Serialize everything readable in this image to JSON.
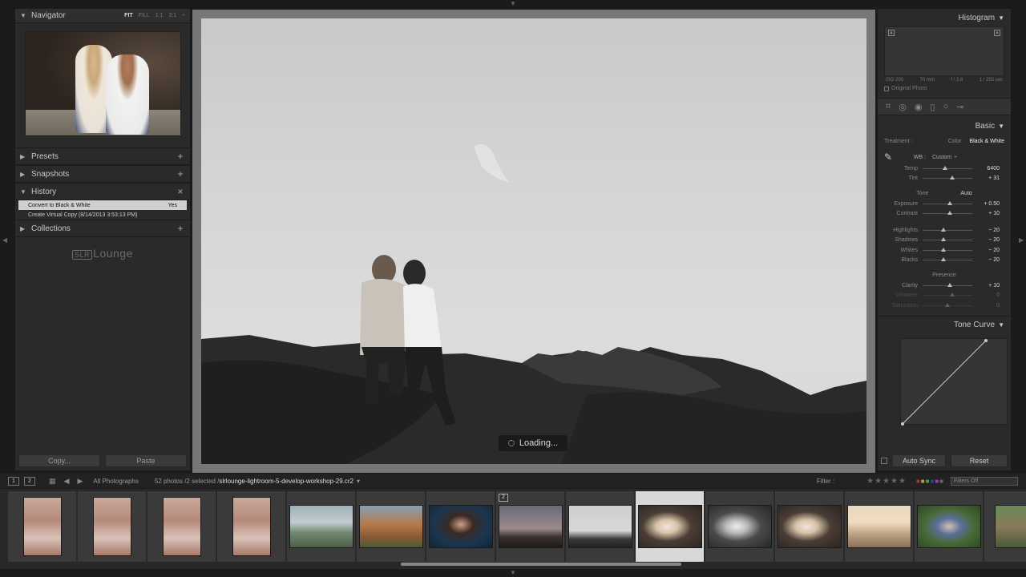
{
  "navigator": {
    "title": "Navigator",
    "zoom_options": [
      "FIT",
      "FILL",
      "1:1",
      "3:1"
    ],
    "zoom_extra": "÷"
  },
  "left_sections": {
    "presets": "Presets",
    "snapshots": "Snapshots",
    "history": "History",
    "collections": "Collections"
  },
  "history": {
    "items": [
      {
        "name": "Convert to Black & White",
        "value": "Yes"
      },
      {
        "name": "Create Virtual Copy (8/14/2013 3:53:13 PM)",
        "value": ""
      }
    ]
  },
  "brand": {
    "box": "SLR",
    "text": "Lounge"
  },
  "left_buttons": {
    "copy": "Copy...",
    "paste": "Paste"
  },
  "loading": "Loading...",
  "histogram": {
    "title": "Histogram",
    "iso": "ISO 200",
    "focal": "70 mm",
    "aperture": "f / 2.8",
    "shutter": "1 / 250 sec",
    "original": "Original Photo"
  },
  "basic": {
    "title": "Basic",
    "treatment_label": "Treatment :",
    "treatment_options": [
      "Color",
      "Black & White"
    ],
    "wb_label": "WB :",
    "wb_value": "Custom",
    "tone_label": "Tone",
    "auto_label": "Auto",
    "presence_label": "Presence",
    "sliders_wb": [
      {
        "label": "Temp",
        "value": "6400",
        "pos": 0.45
      },
      {
        "label": "Tint",
        "value": "+ 31",
        "pos": 0.6
      }
    ],
    "sliders_tone": [
      {
        "label": "Exposure",
        "value": "+ 0.50",
        "pos": 0.55
      },
      {
        "label": "Contrast",
        "value": "+ 10",
        "pos": 0.55
      }
    ],
    "sliders_tone2": [
      {
        "label": "Highlights",
        "value": "− 20",
        "pos": 0.42
      },
      {
        "label": "Shadows",
        "value": "− 20",
        "pos": 0.42
      },
      {
        "label": "Whites",
        "value": "− 20",
        "pos": 0.42
      },
      {
        "label": "Blacks",
        "value": "− 20",
        "pos": 0.42
      }
    ],
    "sliders_presence": [
      {
        "label": "Clarity",
        "value": "+ 10",
        "pos": 0.55
      },
      {
        "label": "Vibrance",
        "value": "0",
        "pos": 0.6
      },
      {
        "label": "Saturation",
        "value": "0",
        "pos": 0.5
      }
    ]
  },
  "tone_curve": {
    "title": "Tone Curve"
  },
  "right_buttons": {
    "auto_sync": "Auto Sync",
    "reset": "Reset"
  },
  "filmstrip_bar": {
    "page1": "1",
    "page2": "2",
    "source": "All Photographs",
    "count": "52 photos /2 selected /",
    "filename": "slrlounge-lightroom-5-develop-workshop-29.cr2",
    "filter_label": "Filter :",
    "filter_value": "Filters Off"
  },
  "filmstrip": {
    "thumbs": [
      {
        "kind": "canyon",
        "selected": false,
        "badge": ""
      },
      {
        "kind": "canyon",
        "selected": false,
        "badge": ""
      },
      {
        "kind": "canyon",
        "selected": false,
        "badge": ""
      },
      {
        "kind": "canyon",
        "selected": false,
        "badge": ""
      },
      {
        "kind": "coast",
        "selected": false,
        "badge": ""
      },
      {
        "kind": "redrock",
        "selected": false,
        "badge": ""
      },
      {
        "kind": "portrait",
        "selected": false,
        "badge": ""
      },
      {
        "kind": "dusk",
        "selected": false,
        "badge": "2"
      },
      {
        "kind": "bwcouple",
        "selected": false,
        "badge": ""
      },
      {
        "kind": "hug",
        "selected": true,
        "badge": ""
      },
      {
        "kind": "hugbw",
        "selected": false,
        "badge": ""
      },
      {
        "kind": "hug",
        "selected": false,
        "badge": ""
      },
      {
        "kind": "beach",
        "selected": false,
        "badge": ""
      },
      {
        "kind": "park",
        "selected": false,
        "badge": ""
      },
      {
        "kind": "park2",
        "selected": false,
        "badge": ""
      }
    ]
  }
}
